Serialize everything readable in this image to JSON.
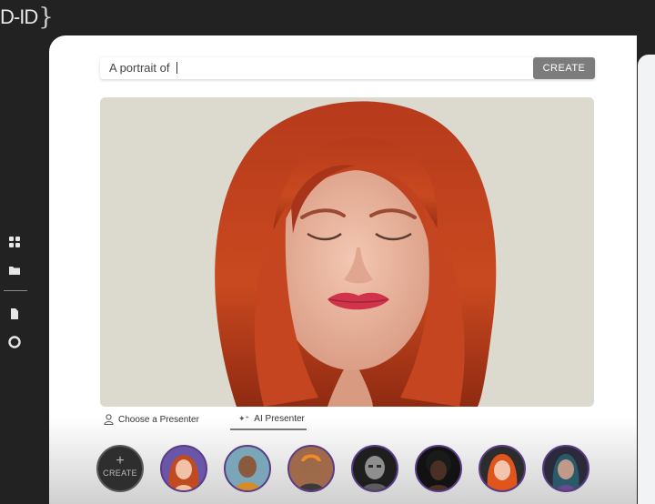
{
  "app": {
    "logo_text": "D-ID",
    "logo_brace": "}"
  },
  "sidebar": {
    "items": [
      {
        "name": "dashboard",
        "icon": "grid-icon"
      },
      {
        "name": "library",
        "icon": "folder-icon"
      },
      {
        "name": "documents",
        "icon": "document-icon"
      },
      {
        "name": "help",
        "icon": "lifebuoy-icon"
      }
    ]
  },
  "prompt": {
    "value": "A portrait of",
    "create_label": "CREATE"
  },
  "canvas": {
    "description_icon": "portrait-image"
  },
  "tabs": [
    {
      "label": "Choose a Presenter",
      "icon": "person-icon",
      "active": false
    },
    {
      "label": "AI Presenter",
      "icon": "sparkle-icon",
      "active": true
    }
  ],
  "presenters": {
    "create_label": "CREATE",
    "create_plus": "+"
  },
  "colors": {
    "accent_border": "#5a3c86",
    "create_button": "#7c7c7c"
  }
}
